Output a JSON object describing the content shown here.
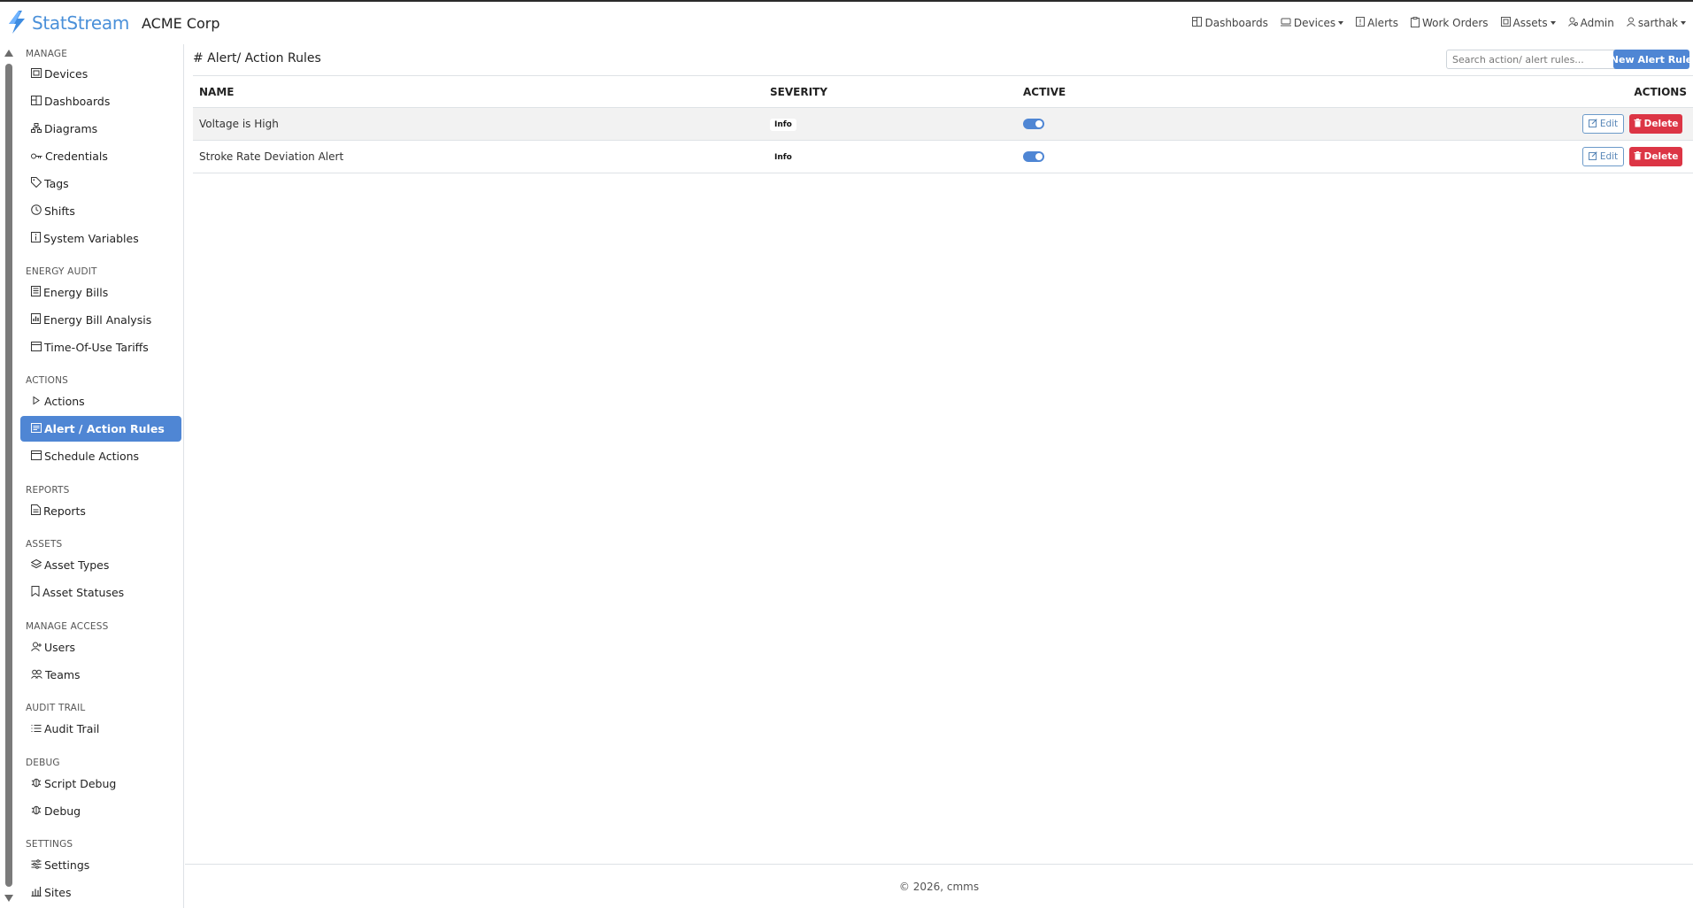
{
  "app": {
    "brand_name": "StatStream",
    "org_name": "ACME Corp",
    "accent_color": "#4f86d4"
  },
  "topnav": {
    "items": [
      {
        "label": "Dashboards",
        "icon": "dashboard-icon"
      },
      {
        "label": "Devices",
        "icon": "devices-icon",
        "dropdown": true
      },
      {
        "label": "Alerts",
        "icon": "alert-icon"
      },
      {
        "label": "Work Orders",
        "icon": "clipboard-icon"
      },
      {
        "label": "Assets",
        "icon": "assets-icon",
        "dropdown": true
      },
      {
        "label": "Admin",
        "icon": "admin-icon"
      },
      {
        "label": "sarthak",
        "icon": "user-icon",
        "dropdown": true
      }
    ]
  },
  "sidebar": {
    "sections": [
      {
        "title": "MANAGE",
        "items": [
          {
            "label": "Devices",
            "icon": "devices-icon"
          },
          {
            "label": "Dashboards",
            "icon": "dashboard-icon"
          },
          {
            "label": "Diagrams",
            "icon": "diagram-icon"
          },
          {
            "label": "Credentials",
            "icon": "key-icon"
          },
          {
            "label": "Tags",
            "icon": "tag-icon"
          },
          {
            "label": "Shifts",
            "icon": "clock-icon"
          },
          {
            "label": "System Variables",
            "icon": "info-icon"
          }
        ]
      },
      {
        "title": "ENERGY AUDIT",
        "items": [
          {
            "label": "Energy Bills",
            "icon": "bill-icon"
          },
          {
            "label": "Energy Bill Analysis",
            "icon": "chart-icon"
          },
          {
            "label": "Time-Of-Use Tariffs",
            "icon": "calendar-icon"
          }
        ]
      },
      {
        "title": "ACTIONS",
        "items": [
          {
            "label": "Actions",
            "icon": "play-icon"
          },
          {
            "label": "Alert / Action Rules",
            "icon": "rules-icon",
            "active": true
          },
          {
            "label": "Schedule Actions",
            "icon": "calendar-icon"
          }
        ]
      },
      {
        "title": "REPORTS",
        "items": [
          {
            "label": "Reports",
            "icon": "report-icon"
          }
        ]
      },
      {
        "title": "ASSETS",
        "items": [
          {
            "label": "Asset Types",
            "icon": "layers-icon"
          },
          {
            "label": "Asset Statuses",
            "icon": "bookmark-icon"
          }
        ]
      },
      {
        "title": "MANAGE ACCESS",
        "items": [
          {
            "label": "Users",
            "icon": "user-icon"
          },
          {
            "label": "Teams",
            "icon": "team-icon"
          }
        ]
      },
      {
        "title": "AUDIT TRAIL",
        "items": [
          {
            "label": "Audit Trail",
            "icon": "list-icon"
          }
        ]
      },
      {
        "title": "DEBUG",
        "items": [
          {
            "label": "Script Debug",
            "icon": "bug-icon"
          },
          {
            "label": "Debug",
            "icon": "bug-icon"
          }
        ]
      },
      {
        "title": "SETTINGS",
        "items": [
          {
            "label": "Settings",
            "icon": "sliders-icon"
          },
          {
            "label": "Sites",
            "icon": "sites-icon"
          }
        ]
      }
    ]
  },
  "main": {
    "title": "# Alert/ Action Rules",
    "search_placeholder": "Search action/ alert rules...",
    "new_button": "New Alert Rule",
    "table": {
      "headers": {
        "name": "NAME",
        "severity": "SEVERITY",
        "active": "ACTIVE",
        "actions": "ACTIONS"
      },
      "rows": [
        {
          "name": "Voltage is High",
          "severity": "Info",
          "active": true
        },
        {
          "name": "Stroke Rate Deviation Alert",
          "severity": "Info",
          "active": true
        }
      ],
      "edit_label": "Edit",
      "delete_label": "Delete"
    }
  },
  "footer": {
    "text": "© 2026, cmms"
  }
}
